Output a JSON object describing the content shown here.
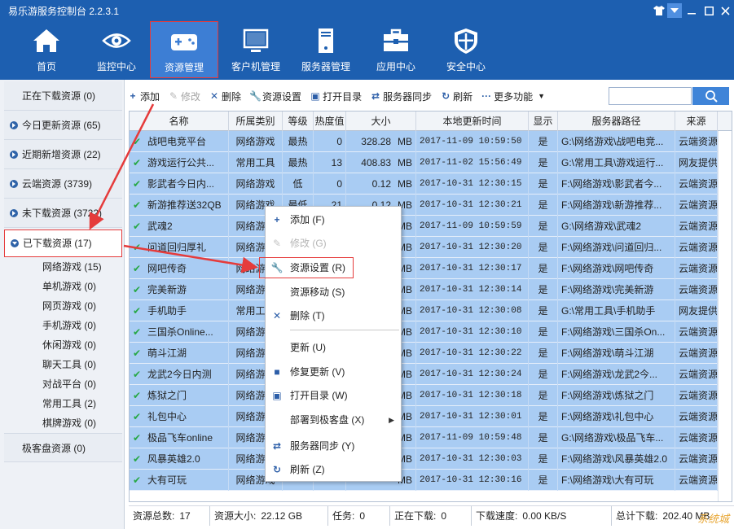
{
  "app": {
    "title": "易乐游服务控制台 2.2.3.1"
  },
  "nav": [
    {
      "label": "首页",
      "icon": "home-icon"
    },
    {
      "label": "监控中心",
      "icon": "eye-icon"
    },
    {
      "label": "资源管理",
      "icon": "gamepad-icon",
      "selected": true
    },
    {
      "label": "客户机管理",
      "icon": "monitor-icon"
    },
    {
      "label": "服务器管理",
      "icon": "server-icon"
    },
    {
      "label": "应用中心",
      "icon": "toolbox-icon"
    },
    {
      "label": "安全中心",
      "icon": "shield-icon"
    }
  ],
  "sidebar": {
    "items": [
      {
        "label": "正在下载资源 (0)"
      },
      {
        "label": "今日更新资源 (65)"
      },
      {
        "label": "近期新增资源 (22)"
      },
      {
        "label": "云端资源 (3739)"
      },
      {
        "label": "未下载资源 (3722)"
      },
      {
        "label": "已下载资源 (17)"
      }
    ],
    "subitems": [
      {
        "label": "网络游戏 (15)"
      },
      {
        "label": "单机游戏 (0)"
      },
      {
        "label": "网页游戏 (0)"
      },
      {
        "label": "手机游戏 (0)"
      },
      {
        "label": "休闲游戏 (0)"
      },
      {
        "label": "聊天工具 (0)"
      },
      {
        "label": "对战平台 (0)"
      },
      {
        "label": "常用工具 (2)"
      },
      {
        "label": "棋牌游戏 (0)"
      }
    ],
    "footer": {
      "label": "极客盘资源 (0)"
    }
  },
  "toolbar": {
    "add": "添加",
    "edit": "修改",
    "delete": "删除",
    "settings": "资源设置",
    "open_dir": "打开目录",
    "sync": "服务器同步",
    "refresh": "刷新",
    "more": "更多功能"
  },
  "table": {
    "headers": [
      "名称",
      "所属类别",
      "等级",
      "热度值",
      "大小",
      "本地更新时间",
      "显示",
      "服务器路径",
      "来源"
    ],
    "rows": [
      {
        "name": "战吧电竞平台",
        "category": "网络游戏",
        "level": "最热",
        "heat": "0",
        "size": "328.28",
        "unit": "MB",
        "time": "2017-11-09 10:59:50",
        "show": "是",
        "path": "G:\\网络游戏\\战吧电竞...",
        "source": "云端资源"
      },
      {
        "name": "游戏运行公共...",
        "category": "常用工具",
        "level": "最热",
        "heat": "13",
        "size": "408.83",
        "unit": "MB",
        "time": "2017-11-02 15:56:49",
        "show": "是",
        "path": "G:\\常用工具\\游戏运行...",
        "source": "网友提供"
      },
      {
        "name": "影武者今日内...",
        "category": "网络游戏",
        "level": "低",
        "heat": "0",
        "size": "0.12",
        "unit": "MB",
        "time": "2017-10-31 12:30:15",
        "show": "是",
        "path": "F:\\网络游戏\\影武者今...",
        "source": "云端资源"
      },
      {
        "name": "新游推荐送32QB",
        "category": "网络游戏",
        "level": "最低",
        "heat": "21",
        "size": "0.12",
        "unit": "MB",
        "time": "2017-10-31 12:30:21",
        "show": "是",
        "path": "F:\\网络游戏\\新游推荐...",
        "source": "云端资源"
      },
      {
        "name": "武魂2",
        "category": "网络游戏",
        "level": "",
        "heat": "",
        "size": "",
        "unit": "MB",
        "time": "2017-11-09 10:59:59",
        "show": "是",
        "path": "G:\\网络游戏\\武魂2",
        "source": "云端资源"
      },
      {
        "name": "问道回归厚礼",
        "category": "网络游戏",
        "level": "",
        "heat": "",
        "size": "",
        "unit": "MB",
        "time": "2017-10-31 12:30:20",
        "show": "是",
        "path": "F:\\网络游戏\\问道回归...",
        "source": "云端资源"
      },
      {
        "name": "网吧传奇",
        "category": "网络游戏",
        "level": "",
        "heat": "",
        "size": "",
        "unit": "MB",
        "time": "2017-10-31 12:30:17",
        "show": "是",
        "path": "F:\\网络游戏\\网吧传奇",
        "source": "云端资源"
      },
      {
        "name": "完美新游",
        "category": "网络游戏",
        "level": "",
        "heat": "",
        "size": "",
        "unit": "MB",
        "time": "2017-10-31 12:30:14",
        "show": "是",
        "path": "F:\\网络游戏\\完美新游",
        "source": "云端资源"
      },
      {
        "name": "手机助手",
        "category": "常用工具",
        "level": "",
        "heat": "",
        "size": "",
        "unit": "MB",
        "time": "2017-10-31 12:30:08",
        "show": "是",
        "path": "G:\\常用工具\\手机助手",
        "source": "网友提供"
      },
      {
        "name": "三国杀Online...",
        "category": "网络游戏",
        "level": "",
        "heat": "",
        "size": "",
        "unit": "MB",
        "time": "2017-10-31 12:30:10",
        "show": "是",
        "path": "F:\\网络游戏\\三国杀On...",
        "source": "云端资源"
      },
      {
        "name": "萌斗江湖",
        "category": "网络游戏",
        "level": "",
        "heat": "",
        "size": "",
        "unit": "MB",
        "time": "2017-10-31 12:30:22",
        "show": "是",
        "path": "F:\\网络游戏\\萌斗江湖",
        "source": "云端资源"
      },
      {
        "name": "龙武2今日内测",
        "category": "网络游戏",
        "level": "",
        "heat": "",
        "size": "",
        "unit": "MB",
        "time": "2017-10-31 12:30:24",
        "show": "是",
        "path": "F:\\网络游戏\\龙武2今...",
        "source": "云端资源"
      },
      {
        "name": "炼狱之门",
        "category": "网络游戏",
        "level": "",
        "heat": "",
        "size": "",
        "unit": "MB",
        "time": "2017-10-31 12:30:18",
        "show": "是",
        "path": "F:\\网络游戏\\炼狱之门",
        "source": "云端资源"
      },
      {
        "name": "礼包中心",
        "category": "网络游戏",
        "level": "",
        "heat": "",
        "size": "",
        "unit": "MB",
        "time": "2017-10-31 12:30:01",
        "show": "是",
        "path": "F:\\网络游戏\\礼包中心",
        "source": "云端资源"
      },
      {
        "name": "极品飞车online",
        "category": "网络游戏",
        "level": "",
        "heat": "",
        "size": "",
        "unit": "MB",
        "time": "2017-11-09 10:59:48",
        "show": "是",
        "path": "G:\\网络游戏\\极品飞车...",
        "source": "云端资源"
      },
      {
        "name": "风暴英雄2.0",
        "category": "网络游戏",
        "level": "",
        "heat": "",
        "size": "",
        "unit": "MB",
        "time": "2017-10-31 12:30:03",
        "show": "是",
        "path": "F:\\网络游戏\\风暴英雄2.0",
        "source": "云端资源"
      },
      {
        "name": "大有可玩",
        "category": "网络游戏",
        "level": "",
        "heat": "",
        "size": "",
        "unit": "MB",
        "time": "2017-10-31 12:30:16",
        "show": "是",
        "path": "F:\\网络游戏\\大有可玩",
        "source": "云端资源"
      }
    ]
  },
  "context_menu": [
    {
      "label": "添加 (F)",
      "icon": "plus-icon",
      "enabled": true
    },
    {
      "label": "修改 (G)",
      "icon": "pencil-icon",
      "enabled": false
    },
    {
      "label": "资源设置 (R)",
      "icon": "wrench-icon",
      "enabled": true,
      "highlighted": true
    },
    {
      "label": "资源移动 (S)",
      "icon": "",
      "enabled": true
    },
    {
      "label": "删除 (T)",
      "icon": "x-icon",
      "enabled": true
    },
    {
      "label": "更新 (U)",
      "icon": "",
      "enabled": true
    },
    {
      "label": "修复更新 (V)",
      "icon": "repair-icon",
      "enabled": true
    },
    {
      "label": "打开目录 (W)",
      "icon": "folder-icon",
      "enabled": true
    },
    {
      "label": "部署到极客盘 (X)",
      "icon": "",
      "enabled": true,
      "submenu": true
    },
    {
      "label": "服务器同步 (Y)",
      "icon": "sync-icon",
      "enabled": true
    },
    {
      "label": "刷新 (Z)",
      "icon": "refresh-icon",
      "enabled": true
    }
  ],
  "status": {
    "total_label": "资源总数:",
    "total": "17",
    "size_label": "资源大小:",
    "size": "22.12 GB",
    "task_label": "任务:",
    "task": "0",
    "downloading_label": "正在下载:",
    "downloading": "0",
    "speed_label": "下载速度:",
    "speed": "0.00 KB/S",
    "total_dl_label": "总计下载:",
    "total_dl": "202.40 MB"
  },
  "watermark": "系统城"
}
